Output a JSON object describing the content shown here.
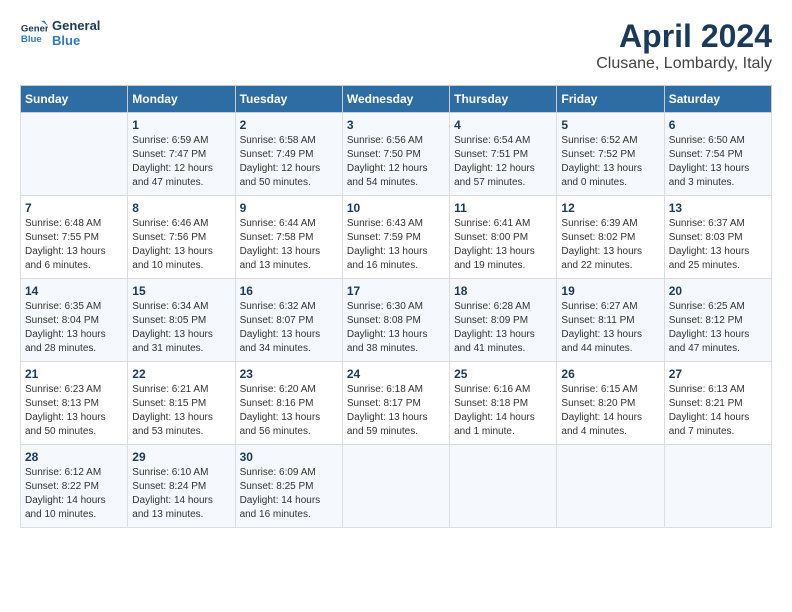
{
  "header": {
    "logo_line1": "General",
    "logo_line2": "Blue",
    "title": "April 2024",
    "subtitle": "Clusane, Lombardy, Italy"
  },
  "weekdays": [
    "Sunday",
    "Monday",
    "Tuesday",
    "Wednesday",
    "Thursday",
    "Friday",
    "Saturday"
  ],
  "weeks": [
    [
      {
        "day": "",
        "info": ""
      },
      {
        "day": "1",
        "info": "Sunrise: 6:59 AM\nSunset: 7:47 PM\nDaylight: 12 hours\nand 47 minutes."
      },
      {
        "day": "2",
        "info": "Sunrise: 6:58 AM\nSunset: 7:49 PM\nDaylight: 12 hours\nand 50 minutes."
      },
      {
        "day": "3",
        "info": "Sunrise: 6:56 AM\nSunset: 7:50 PM\nDaylight: 12 hours\nand 54 minutes."
      },
      {
        "day": "4",
        "info": "Sunrise: 6:54 AM\nSunset: 7:51 PM\nDaylight: 12 hours\nand 57 minutes."
      },
      {
        "day": "5",
        "info": "Sunrise: 6:52 AM\nSunset: 7:52 PM\nDaylight: 13 hours\nand 0 minutes."
      },
      {
        "day": "6",
        "info": "Sunrise: 6:50 AM\nSunset: 7:54 PM\nDaylight: 13 hours\nand 3 minutes."
      }
    ],
    [
      {
        "day": "7",
        "info": "Sunrise: 6:48 AM\nSunset: 7:55 PM\nDaylight: 13 hours\nand 6 minutes."
      },
      {
        "day": "8",
        "info": "Sunrise: 6:46 AM\nSunset: 7:56 PM\nDaylight: 13 hours\nand 10 minutes."
      },
      {
        "day": "9",
        "info": "Sunrise: 6:44 AM\nSunset: 7:58 PM\nDaylight: 13 hours\nand 13 minutes."
      },
      {
        "day": "10",
        "info": "Sunrise: 6:43 AM\nSunset: 7:59 PM\nDaylight: 13 hours\nand 16 minutes."
      },
      {
        "day": "11",
        "info": "Sunrise: 6:41 AM\nSunset: 8:00 PM\nDaylight: 13 hours\nand 19 minutes."
      },
      {
        "day": "12",
        "info": "Sunrise: 6:39 AM\nSunset: 8:02 PM\nDaylight: 13 hours\nand 22 minutes."
      },
      {
        "day": "13",
        "info": "Sunrise: 6:37 AM\nSunset: 8:03 PM\nDaylight: 13 hours\nand 25 minutes."
      }
    ],
    [
      {
        "day": "14",
        "info": "Sunrise: 6:35 AM\nSunset: 8:04 PM\nDaylight: 13 hours\nand 28 minutes."
      },
      {
        "day": "15",
        "info": "Sunrise: 6:34 AM\nSunset: 8:05 PM\nDaylight: 13 hours\nand 31 minutes."
      },
      {
        "day": "16",
        "info": "Sunrise: 6:32 AM\nSunset: 8:07 PM\nDaylight: 13 hours\nand 34 minutes."
      },
      {
        "day": "17",
        "info": "Sunrise: 6:30 AM\nSunset: 8:08 PM\nDaylight: 13 hours\nand 38 minutes."
      },
      {
        "day": "18",
        "info": "Sunrise: 6:28 AM\nSunset: 8:09 PM\nDaylight: 13 hours\nand 41 minutes."
      },
      {
        "day": "19",
        "info": "Sunrise: 6:27 AM\nSunset: 8:11 PM\nDaylight: 13 hours\nand 44 minutes."
      },
      {
        "day": "20",
        "info": "Sunrise: 6:25 AM\nSunset: 8:12 PM\nDaylight: 13 hours\nand 47 minutes."
      }
    ],
    [
      {
        "day": "21",
        "info": "Sunrise: 6:23 AM\nSunset: 8:13 PM\nDaylight: 13 hours\nand 50 minutes."
      },
      {
        "day": "22",
        "info": "Sunrise: 6:21 AM\nSunset: 8:15 PM\nDaylight: 13 hours\nand 53 minutes."
      },
      {
        "day": "23",
        "info": "Sunrise: 6:20 AM\nSunset: 8:16 PM\nDaylight: 13 hours\nand 56 minutes."
      },
      {
        "day": "24",
        "info": "Sunrise: 6:18 AM\nSunset: 8:17 PM\nDaylight: 13 hours\nand 59 minutes."
      },
      {
        "day": "25",
        "info": "Sunrise: 6:16 AM\nSunset: 8:18 PM\nDaylight: 14 hours\nand 1 minute."
      },
      {
        "day": "26",
        "info": "Sunrise: 6:15 AM\nSunset: 8:20 PM\nDaylight: 14 hours\nand 4 minutes."
      },
      {
        "day": "27",
        "info": "Sunrise: 6:13 AM\nSunset: 8:21 PM\nDaylight: 14 hours\nand 7 minutes."
      }
    ],
    [
      {
        "day": "28",
        "info": "Sunrise: 6:12 AM\nSunset: 8:22 PM\nDaylight: 14 hours\nand 10 minutes."
      },
      {
        "day": "29",
        "info": "Sunrise: 6:10 AM\nSunset: 8:24 PM\nDaylight: 14 hours\nand 13 minutes."
      },
      {
        "day": "30",
        "info": "Sunrise: 6:09 AM\nSunset: 8:25 PM\nDaylight: 14 hours\nand 16 minutes."
      },
      {
        "day": "",
        "info": ""
      },
      {
        "day": "",
        "info": ""
      },
      {
        "day": "",
        "info": ""
      },
      {
        "day": "",
        "info": ""
      }
    ]
  ]
}
